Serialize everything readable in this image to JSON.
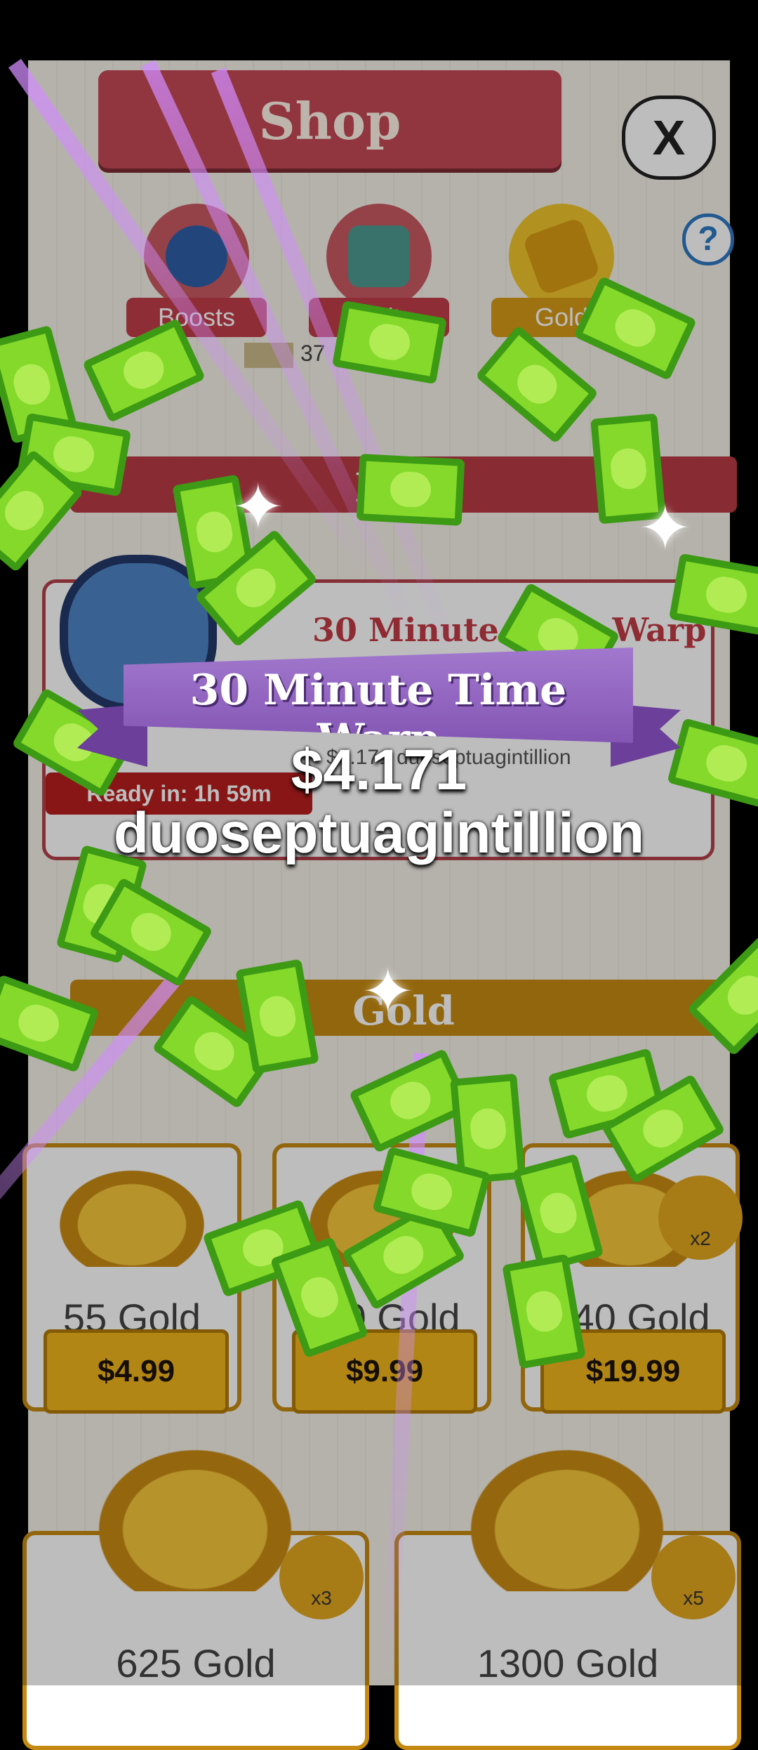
{
  "shop": {
    "title": "Shop",
    "close_label": "X",
    "help_label": "?"
  },
  "tabs": [
    {
      "label": "Boosts",
      "icon": "money-bag-icon"
    },
    {
      "label": "Vaults",
      "icon": "vault-icon"
    },
    {
      "label": "Gold",
      "icon": "gold-bars-icon"
    }
  ],
  "currency": {
    "amount": "37"
  },
  "free_section": {
    "header": "Free"
  },
  "offer": {
    "title": "30 Minute Time Warp",
    "description": "$4.171 duoseptuagintillion",
    "ready_text": "Ready in: 1h 59m"
  },
  "gold_section": {
    "header": "Gold"
  },
  "gold_items": [
    {
      "amount": "55 Gold",
      "price": "$4.99",
      "multiplier": ""
    },
    {
      "amount": "110 Gold",
      "price": "$9.99",
      "multiplier": ""
    },
    {
      "amount": "240 Gold",
      "price": "$19.99",
      "multiplier": "x2"
    },
    {
      "amount": "625 Gold",
      "price": "",
      "multiplier": "x3"
    },
    {
      "amount": "1300 Gold",
      "price": "",
      "multiplier": "x5"
    }
  ],
  "reward_popup": {
    "banner": "30 Minute Time Warp",
    "amount_line1": "$4.171",
    "amount_line2": "duoseptuagintillion"
  },
  "colors": {
    "banner_purple": "#8e63bd",
    "bill_green": "#84d92a",
    "shop_red": "#c44a55",
    "gold": "#f0b51c"
  }
}
